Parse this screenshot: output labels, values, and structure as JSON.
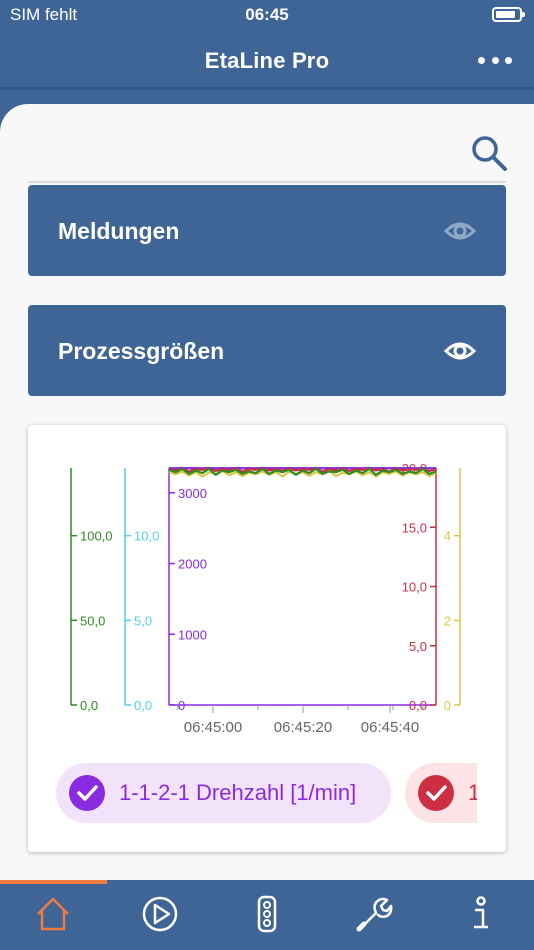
{
  "status_bar": {
    "carrier": "SIM fehlt",
    "time": "06:45"
  },
  "nav": {
    "title": "EtaLine Pro"
  },
  "sections": [
    {
      "label": "Meldungen",
      "eye_state": "muted"
    },
    {
      "label": "Prozessgrößen",
      "eye_state": "active"
    }
  ],
  "chips": [
    {
      "label": "1-1-2-1 Drehzahl [1/min]",
      "color": "#8a2be2",
      "checked": true
    },
    {
      "label": "1",
      "color": "#cc2e42",
      "checked": true
    }
  ],
  "tabs": [
    {
      "icon": "home-icon",
      "active": true
    },
    {
      "icon": "play-icon",
      "active": false
    },
    {
      "icon": "traffic-light-icon",
      "active": false
    },
    {
      "icon": "wrench-icon",
      "active": false
    },
    {
      "icon": "info-icon",
      "active": false
    }
  ],
  "colors": {
    "primary": "#3f6596",
    "accent": "#f07b3f",
    "green": "#2e8b22",
    "cyan": "#4fd0e8",
    "purple": "#8a2be2",
    "red": "#cc2e42",
    "yellow": "#d9c845"
  },
  "chart_data": {
    "type": "line",
    "x_tick_labels": [
      "06:45:00",
      "06:45:20",
      "06:45:40"
    ],
    "axes": [
      {
        "id": "green",
        "color": "#2e8b22",
        "ylim": [
          0,
          140
        ],
        "ticks": [
          0,
          50,
          100
        ],
        "tick_labels": [
          "0,0",
          "50,0",
          "100,0"
        ]
      },
      {
        "id": "cyan",
        "color": "#4fd0e8",
        "ylim": [
          0,
          14
        ],
        "ticks": [
          0,
          5,
          10
        ],
        "tick_labels": [
          "0,0",
          "5,0",
          "10,0"
        ]
      },
      {
        "id": "purple",
        "color": "#8a2be2",
        "ylim": [
          0,
          3350
        ],
        "ticks": [
          0,
          1000,
          2000,
          3000
        ],
        "tick_labels": [
          "0",
          "1000",
          "2000",
          "3000"
        ]
      },
      {
        "id": "red",
        "color": "#cc2e42",
        "ylim": [
          0,
          20
        ],
        "ticks": [
          0,
          5,
          10,
          15,
          20
        ],
        "tick_labels": [
          "0,0",
          "5,0",
          "10,0",
          "15,0",
          "20,0"
        ]
      },
      {
        "id": "yellow",
        "color": "#d9c845",
        "ylim": [
          0,
          5.6
        ],
        "ticks": [
          0,
          2,
          4
        ],
        "tick_labels": [
          "0",
          "2",
          "4"
        ]
      }
    ],
    "series": [
      {
        "axis": "cyan",
        "values": [
          14,
          13.98,
          14,
          13.97,
          14,
          13.99,
          14,
          13.98,
          14,
          13.99,
          14,
          13.98,
          14,
          13.99,
          14,
          13.98,
          14,
          13.99,
          14,
          13.98,
          14,
          14,
          13.99,
          14,
          13.98,
          14,
          13.99,
          14,
          13.98,
          14,
          14,
          13.99,
          14,
          13.98,
          14,
          13.99,
          14,
          13.98,
          14,
          14,
          13.99
        ]
      },
      {
        "axis": "purple",
        "values": [
          3348,
          3345,
          3350,
          3344,
          3349,
          3346,
          3350,
          3343,
          3348,
          3346,
          3350,
          3345,
          3349,
          3344,
          3350,
          3346,
          3348,
          3345,
          3350,
          3344,
          3349,
          3346,
          3350,
          3345,
          3348,
          3344,
          3350,
          3346,
          3349,
          3345,
          3350,
          3344,
          3348,
          3346,
          3350,
          3345,
          3349,
          3344,
          3350,
          3346,
          3348
        ]
      },
      {
        "axis": "red",
        "values": [
          19.9,
          19.8,
          19.95,
          19.7,
          19.9,
          19.85,
          19.95,
          19.75,
          19.9,
          19.8,
          19.95,
          19.7,
          19.9,
          19.85,
          19.95,
          19.8,
          19.9,
          19.75,
          19.95,
          19.8,
          19.9,
          19.85,
          19.95,
          19.7,
          19.9,
          19.8,
          19.95,
          19.75,
          19.9,
          19.85,
          19.95,
          19.8,
          19.9,
          19.7,
          19.95,
          19.8,
          19.9,
          19.85,
          19.95,
          19.75,
          19.9
        ]
      },
      {
        "axis": "yellow",
        "values": [
          5.5,
          5.45,
          5.52,
          5.42,
          5.5,
          5.4,
          5.5,
          5.46,
          5.53,
          5.43,
          5.5,
          5.41,
          5.49,
          5.45,
          5.52,
          5.44,
          5.5,
          5.4,
          5.51,
          5.46,
          5.5,
          5.42,
          5.5,
          5.45,
          5.53,
          5.41,
          5.49,
          5.45,
          5.52,
          5.43,
          5.5,
          5.4,
          5.5,
          5.46,
          5.52,
          5.42,
          5.5,
          5.45,
          5.5,
          5.41,
          5.48
        ]
      },
      {
        "axis": "green",
        "values": [
          139,
          137.5,
          139.5,
          136.5,
          138.5,
          137,
          139.5,
          136,
          138.5,
          137.5,
          139,
          136.5,
          138,
          137,
          139.5,
          136.5,
          138.5,
          137.5,
          139,
          136,
          138.5,
          137,
          139.5,
          136.5,
          138,
          137.5,
          139,
          136.5,
          138.5,
          137,
          139.5,
          136,
          138.5,
          137.5,
          139,
          136.5,
          138,
          137,
          139.5,
          136.5,
          138
        ]
      }
    ]
  }
}
